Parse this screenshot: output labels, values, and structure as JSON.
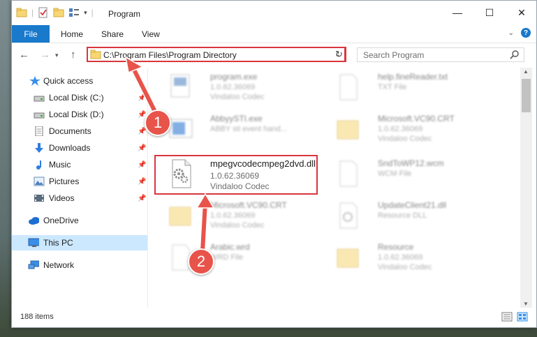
{
  "window": {
    "title": "Program",
    "minimize": "—",
    "maximize": "☐",
    "close": "✕"
  },
  "ribbon": {
    "tabs": [
      "File",
      "Home",
      "Share",
      "View"
    ],
    "help": "?"
  },
  "address": {
    "path": "C:\\Program Files\\Program Directory"
  },
  "search": {
    "placeholder": "Search Program"
  },
  "nav": {
    "items": [
      {
        "label": "Quick access",
        "icon": "star-icon"
      },
      {
        "label": "Local Disk (C:)",
        "icon": "drive-icon"
      },
      {
        "label": "Local Disk (D:)",
        "icon": "drive-icon"
      },
      {
        "label": "Documents",
        "icon": "documents-icon"
      },
      {
        "label": "Downloads",
        "icon": "download-icon"
      },
      {
        "label": "Music",
        "icon": "music-icon"
      },
      {
        "label": "Pictures",
        "icon": "pictures-icon"
      },
      {
        "label": "Videos",
        "icon": "videos-icon"
      },
      {
        "label": "OneDrive",
        "icon": "cloud-icon"
      },
      {
        "label": "This PC",
        "icon": "pc-icon"
      },
      {
        "label": "Network",
        "icon": "network-icon"
      }
    ]
  },
  "files": [
    {
      "name": "program.exe",
      "line1": "1.0.62.36069",
      "line2": "Vindaloo Codec"
    },
    {
      "name": "help.fineReader.txt",
      "line1": "TXT File",
      "line2": ""
    },
    {
      "name": "AbbyySTI.exe",
      "line1": "ABBY sti event hand...",
      "line2": ""
    },
    {
      "name": "Microsoft.VC90.CRT",
      "line1": "1.0.62.36069",
      "line2": "Vindaloo Codec"
    },
    {
      "name": "mpegvcodecmpeg2dvd.dll",
      "line1": "1.0.62.36069",
      "line2": "Vindaloo Codec"
    },
    {
      "name": "SndToWP12.wcm",
      "line1": "WCM File",
      "line2": ""
    },
    {
      "name": "Microsoft.VC90.CRT",
      "line1": "1.0.62.36069",
      "line2": "Vindaloo Codec"
    },
    {
      "name": "UpdateClient21.dll",
      "line1": "Resource DLL",
      "line2": ""
    },
    {
      "name": "Arabic.wrd",
      "line1": "WRD File",
      "line2": ""
    },
    {
      "name": "Resource",
      "line1": "1.0.62.36069",
      "line2": "Vindaloo Codec"
    }
  ],
  "status": {
    "count": "188 items"
  },
  "callouts": [
    "1",
    "2"
  ],
  "colors": {
    "accent": "#1979ca",
    "highlight": "#d9363e",
    "callout": "#e8534a",
    "selection": "#cce8ff"
  }
}
